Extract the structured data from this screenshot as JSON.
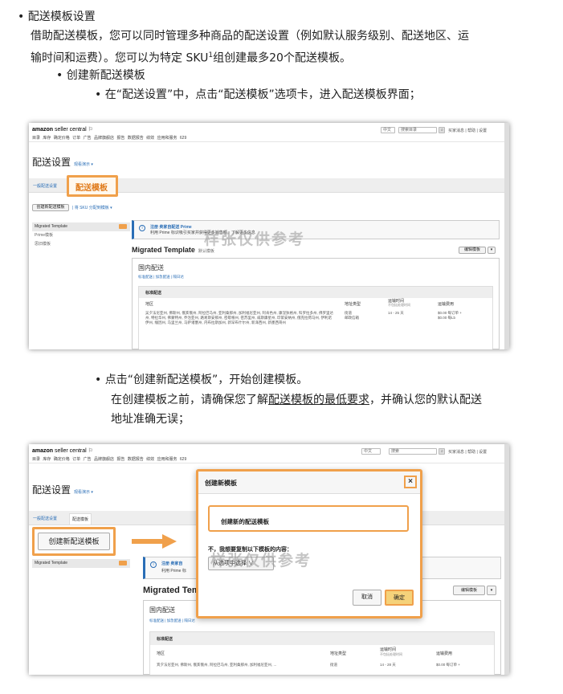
{
  "doc": {
    "b1_label": "配送模板设置",
    "p1_line1": "借助配送模板，您可以同时管理多种商品的配送设置（例如默认服务级别、配送地区、运",
    "p1_line2a": "输时间和运费）。您可以为特定 SKU",
    "p1_sup": "1",
    "p1_line2b": "组创建最多20个配送模板。",
    "b2_label": "创建新配送模板",
    "b3_label": "在“配送设置”中，点击“配送模板”选项卡，进入配送模板界面；",
    "b4_label": "点击“创建新配送模板”，开始创建模板。",
    "p2_line1a": "在创建模板之前，请确保您了解",
    "p2_link": "配送模板的最低要求",
    "p2_line1b": "，并确认您的默认配送",
    "p2_line2": "地址准确无误；"
  },
  "shot1": {
    "logo_brand": "amazon",
    "logo_rest": " seller central",
    "nav": "目录  库存  确定价格  订单  广告  品牌旗舰店  报告  数据报告  绩效  应用和服务  629",
    "lang": "中文",
    "search_ph": "搜索目录",
    "links": "买家消息 | 帮助 | 设置",
    "page_title": "配送设置",
    "page_title_link": "观看演示 ▾",
    "tab_general": "一般配送设置",
    "tab_templates": "配送模板",
    "create_btn": "创建新配送模板",
    "sku_link": "| 将 SKU 分配到模板 ▾",
    "side_items": [
      "Migrated Template",
      "Prime模板",
      "思旧模板"
    ],
    "prime_title": "注册 卖家自配送 Prime",
    "prime_sub": "利用 Prime 标识吸引买家并获得更多销售额。了解更多信息",
    "tpl_title": "Migrated Template",
    "tpl_default": "默认模板",
    "edit_btn": "编辑模板",
    "pane_title": "国内配送",
    "pane_links": "标准配送 | 加急配送 | 隔日达",
    "sec_label": "标准配送",
    "col_region": "地区",
    "col_addr": "地址类型",
    "col_time": "运输时间",
    "col_time_sub": "不包括处理时间",
    "col_fee": "运输费用",
    "row_region": "吴夕法尼亚州, 佛斯州, 俄亥俄州, 阿拉巴马州, 亚利桑那州, 加利福尼亚州, 阿肯色州, 康涅狄格州, 科罗拉多州, 佛罗里达州, 特拉华州, 佛蒙特州, 乔治亚州, 路易斯安那州, 密歇根州, 密苏里州, 威斯康星州, 印第安纳州, 俄克拉荷马州, 伊利诺伊州, 缅因州, 马里兰州, 马萨诸塞州, 内布拉斯加州, 新罕布什尔州, 新泽西州, 新墨西哥州",
    "row_addr": "街道\n邮政信箱",
    "row_time": "14 - 25 天",
    "row_fee": "$0.00 每订单 +\n$0.00 每Lb",
    "watermark": "样张仅供参考"
  },
  "shot2": {
    "logo_brand": "amazon",
    "logo_rest": " seller central",
    "nav": "目录  库存  确定价格  订单  广告  品牌旗舰店  报告  数据报告  绩效  应用和服务  629",
    "lang": "中文",
    "search_ph": "搜索",
    "links": "买家消息 | 帮助 | 设置",
    "page_title": "配送设置",
    "page_title_link": "观看演示 ▾",
    "tab_general": "一般配送设置",
    "tab_templates": "配送模板",
    "create_btn": "创建新配送模板",
    "side_items": [
      "Migrated Template"
    ],
    "prime_title": "注册 卖家自",
    "prime_sub": "利用 Prime 标",
    "tpl_title": "Migrated Tem",
    "edit_btn": "编辑模板",
    "pane_title": "国内配送",
    "pane_links": "标准配送 | 加急配送 | 隔日达",
    "sec_label": "标准配送",
    "col_region": "地区",
    "col_addr": "地址类型",
    "col_time": "运输时间",
    "col_time_sub": "不包括处理时间",
    "col_fee": "运输费用",
    "row_region": "宾夕法尼亚州, 佛斯州, 俄亥俄州, 阿拉巴马州, 亚利桑那州, 加利福尼亚州, ...",
    "row_addr": "街道",
    "row_time": "14 - 28 天",
    "row_fee": "$0.00 每订单 +",
    "modal_title": "创建新模板",
    "modal_close": "×",
    "modal_input": "创建新的配送模板",
    "modal_question": "不，我想要复制以下模板的内容：",
    "modal_select": "从选项中选择",
    "modal_cancel": "取消",
    "modal_ok": "确定",
    "watermark": "样张仅供参考"
  },
  "colors": {
    "accent": "#f0a04b",
    "link": "#2a6eb6"
  }
}
